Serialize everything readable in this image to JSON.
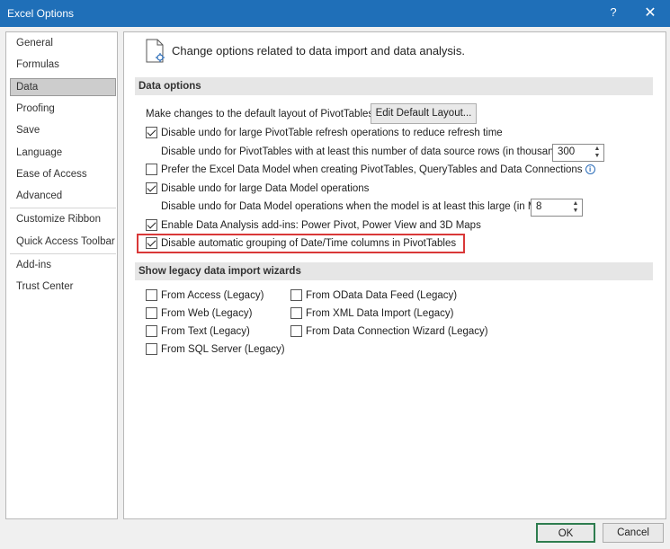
{
  "window": {
    "title": "Excel Options",
    "help": "?",
    "close": "✕"
  },
  "sidebar": {
    "items": [
      {
        "label": "General"
      },
      {
        "label": "Formulas"
      },
      {
        "label": "Data"
      },
      {
        "label": "Proofing"
      },
      {
        "label": "Save"
      },
      {
        "label": "Language"
      },
      {
        "label": "Ease of Access"
      },
      {
        "label": "Advanced"
      },
      {
        "label": "Customize Ribbon"
      },
      {
        "label": "Quick Access Toolbar"
      },
      {
        "label": "Add-ins"
      },
      {
        "label": "Trust Center"
      }
    ],
    "active": "Data"
  },
  "main": {
    "header": "Change options related to data import and data analysis.",
    "data_options": {
      "title": "Data options",
      "default_layout_label": "Make changes to the default layout of PivotTables:",
      "edit_default_layout_button": "Edit Default Layout...",
      "options": [
        {
          "label": "Disable undo for large PivotTable refresh operations to reduce refresh time",
          "checked": true
        },
        {
          "label": "Disable undo for PivotTables with at least this number of data source rows (in thousands):",
          "value": "300"
        },
        {
          "label": "Prefer the Excel Data Model when creating PivotTables, QueryTables and Data Connections",
          "checked": false
        },
        {
          "label": "Disable undo for large Data Model operations",
          "checked": true
        },
        {
          "label": "Disable undo for Data Model operations when the model is at least this large (in MB):",
          "value": "8"
        },
        {
          "label": "Enable Data Analysis add-ins: Power Pivot, Power View and 3D Maps",
          "checked": true
        },
        {
          "label": "Disable automatic grouping of Date/Time columns in PivotTables",
          "checked": true
        }
      ]
    },
    "legacy": {
      "title": "Show legacy data import wizards",
      "left": [
        {
          "label": "From Access (Legacy)",
          "checked": false
        },
        {
          "label": "From Web (Legacy)",
          "checked": false
        },
        {
          "label": "From Text (Legacy)",
          "checked": false
        },
        {
          "label": "From SQL Server (Legacy)",
          "checked": false
        }
      ],
      "right": [
        {
          "label": "From OData Data Feed (Legacy)",
          "checked": false
        },
        {
          "label": "From XML Data Import (Legacy)",
          "checked": false
        },
        {
          "label": "From Data Connection Wizard (Legacy)",
          "checked": false
        }
      ]
    }
  },
  "footer": {
    "ok": "OK",
    "cancel": "Cancel"
  },
  "colors": {
    "titlebar": "#1f6fb8",
    "highlight": "#d93838",
    "ok_border": "#2e7d4f"
  }
}
